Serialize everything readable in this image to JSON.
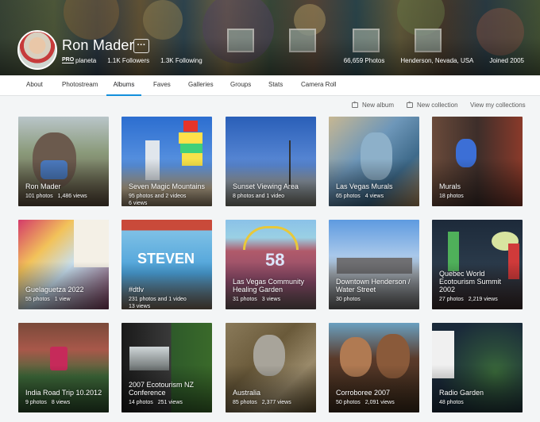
{
  "profile": {
    "name": "Ron Mader",
    "more_label": "···",
    "pro_label": "PRO",
    "username": "planeta",
    "followers": "1.1K Followers",
    "following": "1.3K Following",
    "photos_count": "66,659 Photos",
    "location": "Henderson, Nevada, USA",
    "joined": "Joined 2005"
  },
  "nav": {
    "items": [
      "About",
      "Photostream",
      "Albums",
      "Faves",
      "Galleries",
      "Groups",
      "Stats",
      "Camera Roll"
    ],
    "active": "Albums"
  },
  "toolbar": {
    "new_album": "New album",
    "new_collection": "New collection",
    "view_collections": "View my collections"
  },
  "albums": [
    {
      "title": "Ron Mader",
      "photos": "101 photos",
      "views": "1,486 views"
    },
    {
      "title": "Seven Magic Mountains",
      "photos": "95 photos and 2 videos",
      "views": "6 views"
    },
    {
      "title": "Sunset Viewing Area",
      "photos": "8 photos and 1 video",
      "views": ""
    },
    {
      "title": "Las Vegas Murals",
      "photos": "65 photos",
      "views": "4 views"
    },
    {
      "title": "Murals",
      "photos": "18 photos",
      "views": ""
    },
    {
      "title": "Guelaguetza 2022",
      "photos": "55 photos",
      "views": "1 view"
    },
    {
      "title": "#dtlv",
      "photos": "231 photos and 1 video",
      "views": "13 views"
    },
    {
      "title": "Las Vegas Community Healing Garden",
      "photos": "31 photos",
      "views": "3 views"
    },
    {
      "title": "Downtown Henderson / Water Street",
      "photos": "30 photos",
      "views": ""
    },
    {
      "title": "Quebec World Ecotourism Summit 2002",
      "photos": "27 photos",
      "views": "2,219 views"
    },
    {
      "title": "India Road Trip 10.2012",
      "photos": "9 photos",
      "views": "8 views"
    },
    {
      "title": "2007 Ecotourism NZ Conference",
      "photos": "14 photos",
      "views": "251 views"
    },
    {
      "title": "Australia",
      "photos": "85 photos",
      "views": "2,377 views"
    },
    {
      "title": "Corroboree 2007",
      "photos": "50 photos",
      "views": "2,091 views"
    },
    {
      "title": "Radio Garden",
      "photos": "48 photos",
      "views": ""
    }
  ]
}
